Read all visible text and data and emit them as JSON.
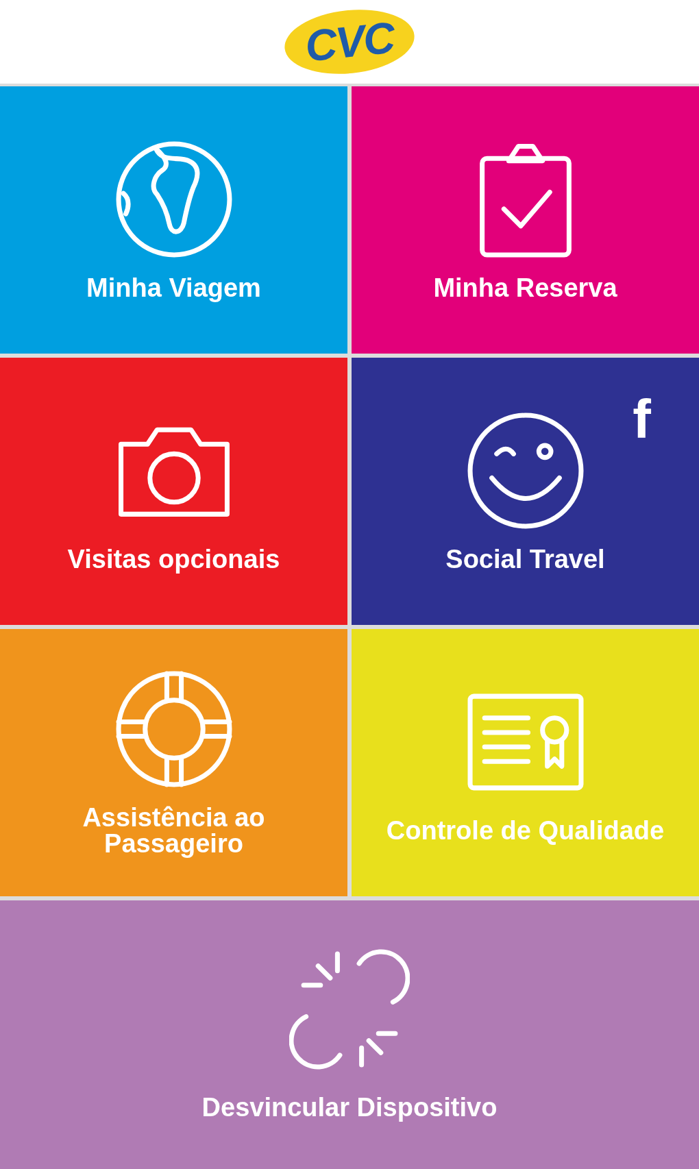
{
  "logo": {
    "text": "CVC"
  },
  "tiles": [
    {
      "kind": "globe",
      "label": "Minha Viagem",
      "color": "#009fe0"
    },
    {
      "kind": "clipboard",
      "label": "Minha Reserva",
      "color": "#e2007a"
    },
    {
      "kind": "camera",
      "label": "Visitas opcionais",
      "color": "#ec1c24"
    },
    {
      "kind": "smiley",
      "label": "Social Travel",
      "color": "#2e3192",
      "badge": "f"
    },
    {
      "kind": "lifebuoy",
      "label": "Assistência ao Passageiro",
      "color": "#f0941c"
    },
    {
      "kind": "certificate",
      "label": "Controle de Qualidade",
      "color": "#e8e01c"
    }
  ],
  "footer": {
    "kind": "unlink",
    "label": "Desvincular Dispositivo",
    "color": "#b07bb4"
  }
}
